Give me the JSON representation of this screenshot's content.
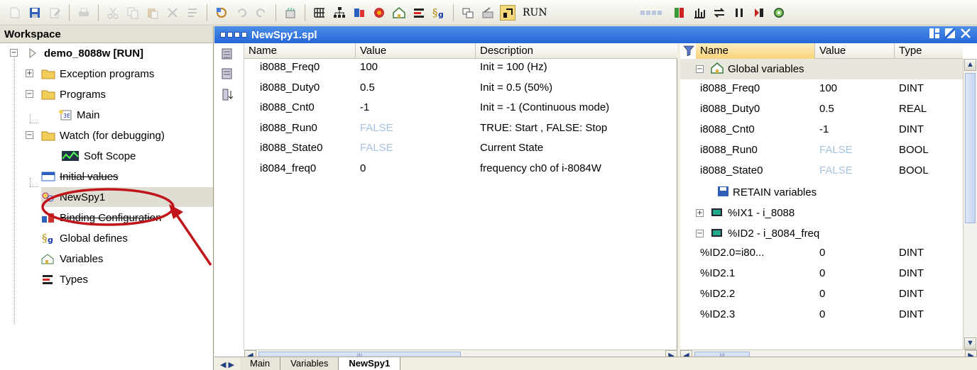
{
  "toolbar": {
    "run_label": "RUN"
  },
  "workspace": {
    "title": "Workspace",
    "root": "demo_8088w [RUN]",
    "items": [
      {
        "label": "Exception programs"
      },
      {
        "label": "Programs"
      },
      {
        "label": "Main"
      },
      {
        "label": "Watch (for debugging)"
      },
      {
        "label": "Soft Scope"
      },
      {
        "label": "Initial values"
      },
      {
        "label": "NewSpy1"
      },
      {
        "label": "Binding Configuration"
      },
      {
        "label": "Global defines"
      },
      {
        "label": "Variables"
      },
      {
        "label": "Types"
      }
    ]
  },
  "spy": {
    "title": "NewSpy1.spl",
    "columns": {
      "name": "Name",
      "value": "Value",
      "description": "Description"
    },
    "rows": [
      {
        "name": "i8088_Freq0",
        "value": "100",
        "description": "Init = 100 (Hz)"
      },
      {
        "name": "i8088_Duty0",
        "value": "0.5",
        "description": "Init = 0.5 (50%)"
      },
      {
        "name": "i8088_Cnt0",
        "value": "-1",
        "description": "Init = -1 (Continuous mode)"
      },
      {
        "name": "i8088_Run0",
        "value": "FALSE",
        "description": "TRUE: Start , FALSE: Stop"
      },
      {
        "name": "i8088_State0",
        "value": "FALSE",
        "description": "Current State"
      },
      {
        "name": "i8084_freq0",
        "value": "0",
        "description": "frequency ch0 of i-8084W"
      }
    ],
    "scroll_mid": "III"
  },
  "vars": {
    "columns": {
      "name": "Name",
      "value": "Value",
      "type": "Type"
    },
    "global_label": "Global variables",
    "global_rows": [
      {
        "name": "i8088_Freq0",
        "value": "100",
        "type": "DINT"
      },
      {
        "name": "i8088_Duty0",
        "value": "0.5",
        "type": "REAL"
      },
      {
        "name": "i8088_Cnt0",
        "value": "-1",
        "type": "DINT"
      },
      {
        "name": "i8088_Run0",
        "value": "FALSE",
        "type": "BOOL"
      },
      {
        "name": "i8088_State0",
        "value": "FALSE",
        "type": "BOOL"
      }
    ],
    "retain_label": "RETAIN variables",
    "ix1_label": "%IX1 - i_8088",
    "id2_label": "%ID2 - i_8084_freq",
    "id2_rows": [
      {
        "name": "%ID2.0=i80...",
        "value": "0",
        "type": "DINT"
      },
      {
        "name": "%ID2.1",
        "value": "0",
        "type": "DINT"
      },
      {
        "name": "%ID2.2",
        "value": "0",
        "type": "DINT"
      },
      {
        "name": "%ID2.3",
        "value": "0",
        "type": "DINT"
      }
    ],
    "scroll_mid": "III"
  },
  "tabs": [
    {
      "label": "Main"
    },
    {
      "label": "Variables"
    },
    {
      "label": "NewSpy1"
    }
  ],
  "colors": {
    "accent": "#2766d8",
    "false_value": "#a7c2de",
    "annotation": "#c0151b"
  }
}
